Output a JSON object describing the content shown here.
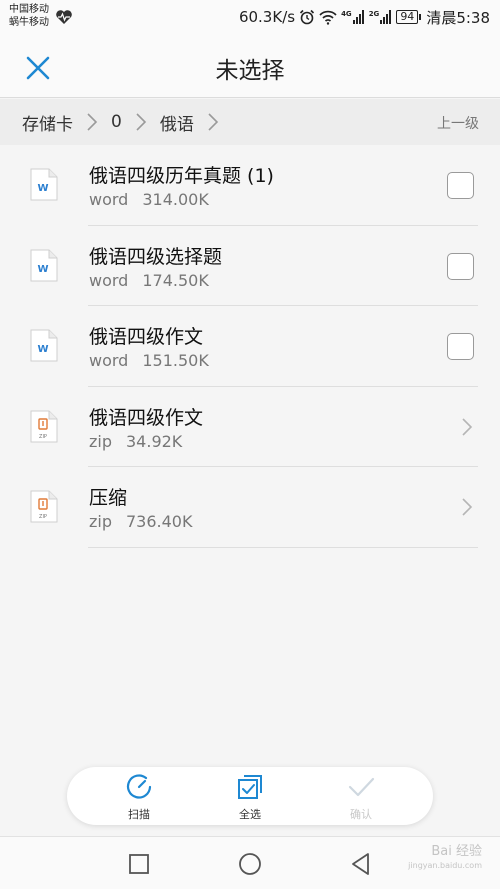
{
  "status_bar": {
    "carrier_1": "中国移动",
    "carrier_2": "蜗牛移动",
    "net_speed": "60.3K/s",
    "signal_label_1": "4G",
    "signal_label_2": "2G",
    "battery": "94",
    "time": "清晨5:38"
  },
  "header": {
    "title": "未选择"
  },
  "breadcrumb": {
    "items": [
      "存储卡",
      "0",
      "俄语"
    ],
    "up_level": "上一级"
  },
  "files": [
    {
      "name": "俄语四级历年真题 (1)",
      "type": "word",
      "size": "314.00K",
      "icon": "word-doc-icon",
      "action": "checkbox"
    },
    {
      "name": "俄语四级选择题",
      "type": "word",
      "size": "174.50K",
      "icon": "word-doc-icon",
      "action": "checkbox"
    },
    {
      "name": "俄语四级作文",
      "type": "word",
      "size": "151.50K",
      "icon": "word-doc-icon",
      "action": "checkbox"
    },
    {
      "name": "俄语四级作文",
      "type": "zip",
      "size": "34.92K",
      "icon": "zip-file-icon",
      "action": "chevron"
    },
    {
      "name": "压缩",
      "type": "zip",
      "size": "736.40K",
      "icon": "zip-file-icon",
      "action": "chevron"
    }
  ],
  "file_icon_labels": {
    "word": "W",
    "zip": "ZIP"
  },
  "actions": {
    "scan": "扫描",
    "select_all": "全选",
    "confirm": "确认"
  },
  "watermark": {
    "line1": "Bai 经验",
    "line2": "jingyan.baidu.com"
  },
  "colors": {
    "accent": "#1e88d2",
    "word_icon": "#2b7fd0",
    "zip_icon": "#e07b39",
    "disabled": "#cfd8e0"
  }
}
